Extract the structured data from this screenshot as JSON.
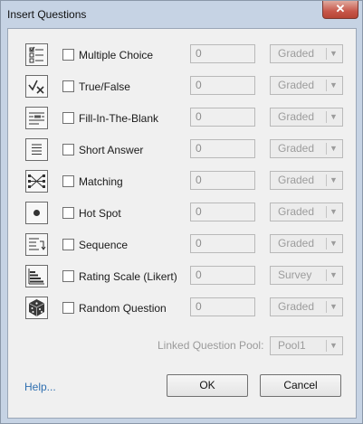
{
  "window": {
    "title": "Insert Questions",
    "close_label": "✕"
  },
  "questions": [
    {
      "label": "Multiple Choice",
      "count": "0",
      "grading": "Graded",
      "icon": "multiple-choice-icon"
    },
    {
      "label": "True/False",
      "count": "0",
      "grading": "Graded",
      "icon": "true-false-icon"
    },
    {
      "label": "Fill-In-The-Blank",
      "count": "0",
      "grading": "Graded",
      "icon": "fill-in-blank-icon"
    },
    {
      "label": "Short Answer",
      "count": "0",
      "grading": "Graded",
      "icon": "short-answer-icon"
    },
    {
      "label": "Matching",
      "count": "0",
      "grading": "Graded",
      "icon": "matching-icon"
    },
    {
      "label": "Hot Spot",
      "count": "0",
      "grading": "Graded",
      "icon": "hot-spot-icon"
    },
    {
      "label": "Sequence",
      "count": "0",
      "grading": "Graded",
      "icon": "sequence-icon"
    },
    {
      "label": "Rating Scale (Likert)",
      "count": "0",
      "grading": "Survey",
      "icon": "rating-scale-icon"
    },
    {
      "label": "Random Question",
      "count": "0",
      "grading": "Graded",
      "icon": "random-question-icon"
    }
  ],
  "pool": {
    "label": "Linked Question Pool:",
    "value": "Pool1"
  },
  "footer": {
    "help_label": "Help...",
    "ok_label": "OK",
    "cancel_label": "Cancel"
  },
  "colors": {
    "frame": "#c6d3e4",
    "client": "#f0f0f0",
    "link": "#2f6fb0",
    "close": "#c7574a",
    "disabled_text": "#9c9c9c"
  }
}
